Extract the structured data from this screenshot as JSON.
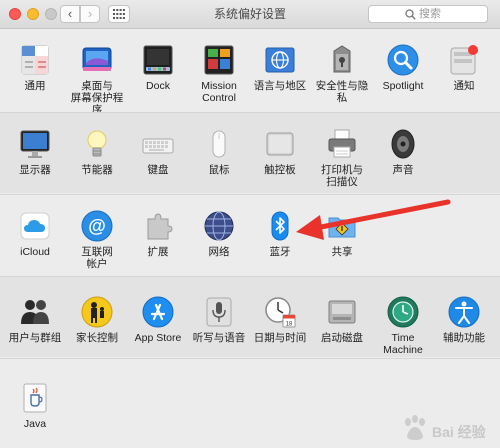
{
  "window": {
    "title": "系统偏好设置"
  },
  "toolbar": {
    "back_glyph": "‹",
    "forward_glyph": "›",
    "show_all_icon": "grid-icon",
    "search_placeholder": "搜索"
  },
  "rows": [
    {
      "items": [
        {
          "label": "通用",
          "icon": "general-icon"
        },
        {
          "label": "桌面与\n屏幕保护程序",
          "icon": "desktop-icon"
        },
        {
          "label": "Dock",
          "icon": "dock-icon"
        },
        {
          "label": "Mission\nControl",
          "icon": "mission-control-icon"
        },
        {
          "label": "语言与地区",
          "icon": "language-region-icon"
        },
        {
          "label": "安全性与隐私",
          "icon": "security-icon"
        },
        {
          "label": "Spotlight",
          "icon": "spotlight-icon"
        },
        {
          "label": "通知",
          "icon": "notifications-icon"
        }
      ]
    },
    {
      "items": [
        {
          "label": "显示器",
          "icon": "display-icon"
        },
        {
          "label": "节能器",
          "icon": "energy-saver-icon"
        },
        {
          "label": "键盘",
          "icon": "keyboard-icon"
        },
        {
          "label": "鼠标",
          "icon": "mouse-icon"
        },
        {
          "label": "触控板",
          "icon": "trackpad-icon"
        },
        {
          "label": "打印机与\n扫描仪",
          "icon": "printer-icon"
        },
        {
          "label": "声音",
          "icon": "sound-icon"
        }
      ]
    },
    {
      "items": [
        {
          "label": "iCloud",
          "icon": "icloud-icon"
        },
        {
          "label": "互联网\n帐户",
          "icon": "internet-accounts-icon"
        },
        {
          "label": "扩展",
          "icon": "extensions-icon"
        },
        {
          "label": "网络",
          "icon": "network-icon"
        },
        {
          "label": "蓝牙",
          "icon": "bluetooth-icon"
        },
        {
          "label": "共享",
          "icon": "sharing-icon"
        }
      ]
    },
    {
      "items": [
        {
          "label": "用户与群组",
          "icon": "users-groups-icon"
        },
        {
          "label": "家长控制",
          "icon": "parental-controls-icon"
        },
        {
          "label": "App Store",
          "icon": "app-store-icon"
        },
        {
          "label": "听写与语音",
          "icon": "dictation-icon"
        },
        {
          "label": "日期与时间",
          "icon": "date-time-icon"
        },
        {
          "label": "启动磁盘",
          "icon": "startup-disk-icon"
        },
        {
          "label": "Time Machine",
          "icon": "time-machine-icon"
        },
        {
          "label": "辅助功能",
          "icon": "accessibility-icon"
        }
      ]
    },
    {
      "items": [
        {
          "label": "Java",
          "icon": "java-icon"
        }
      ]
    }
  ],
  "annotation": {
    "arrow_color": "#e8322a"
  },
  "watermark": {
    "text": "Bai 经验"
  },
  "colors": {
    "close": "#fc5b57",
    "minimize": "#fdbc2e",
    "accent_blue": "#1a8cf0"
  }
}
